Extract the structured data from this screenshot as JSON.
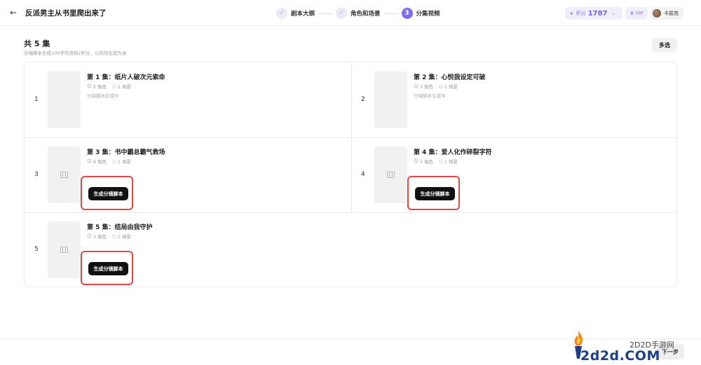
{
  "header": {
    "back_icon": "arrow-left-icon",
    "project_title": "反派男主从书里爬出来了",
    "steps": [
      {
        "number": "1",
        "label": "剧本大纲",
        "state": "done"
      },
      {
        "number": "2",
        "label": "角色和场景",
        "state": "done"
      },
      {
        "number": "3",
        "label": "分集视频",
        "state": "active"
      }
    ],
    "points_label": "积分",
    "points_value": "1787",
    "vip_label": "VIP",
    "user_name": "卡兹克",
    "accent_color": "#7b6ef0"
  },
  "summary": {
    "title": "共 5 集",
    "subtitle": "分镜脚本生成100字符消耗2积分，以实际生成为准",
    "multi_select_label": "多选"
  },
  "episodes": [
    {
      "index": "1",
      "title": "第 1 集：纸片人破次元索命",
      "roles": "2 角色",
      "scenes": "1 场景",
      "status": "分镜脚本生成中",
      "action": ""
    },
    {
      "index": "2",
      "title": "第 2 集：心悦我设定可破",
      "roles": "3 角色",
      "scenes": "1 场景",
      "status": "分镜脚本生成中",
      "action": ""
    },
    {
      "index": "3",
      "title": "第 3 集：书中霸总霸气救场",
      "roles": "4 角色",
      "scenes": "1 场景",
      "status": "",
      "action": "生成分镜脚本"
    },
    {
      "index": "4",
      "title": "第 4 集：爱人化作碎裂字符",
      "roles": "2 角色",
      "scenes": "1 场景",
      "status": "",
      "action": "生成分镜脚本"
    },
    {
      "index": "5",
      "title": "第 5 集：结局由我守护",
      "roles": "3 角色",
      "scenes": "1 场景",
      "status": "",
      "action": "生成分镜脚本"
    }
  ],
  "footer": {
    "next_label": "下一步"
  },
  "watermark": {
    "line1": "2D2D手游网",
    "line2": "2d2d.COM"
  },
  "highlight_color": "#e04848"
}
